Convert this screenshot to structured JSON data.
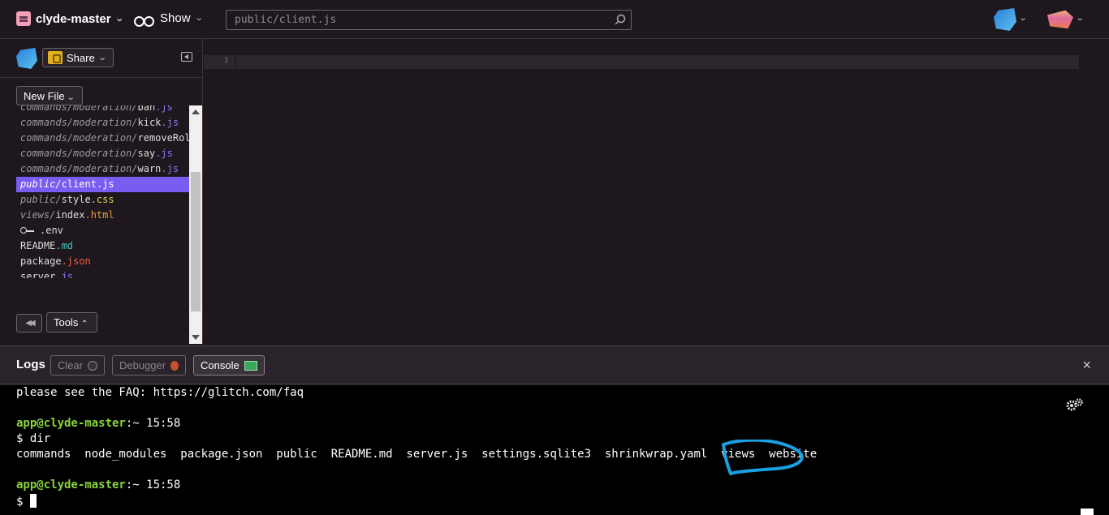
{
  "header": {
    "project_name": "clyde-master",
    "show_label": "Show",
    "search_value": "public/client.js"
  },
  "sidebar": {
    "share_label": "Share",
    "new_file_label": "New File",
    "tools_label": "Tools",
    "files": [
      {
        "dir": "commands/moderation/",
        "name": "ban",
        "ext": ".js",
        "ext_class": "ext-js"
      },
      {
        "dir": "commands/moderation/",
        "name": "kick",
        "ext": ".js",
        "ext_class": "ext-js"
      },
      {
        "dir": "commands/moderation/",
        "name": "removeRol",
        "ext": "",
        "ext_class": "ext-js"
      },
      {
        "dir": "commands/moderation/",
        "name": "say",
        "ext": ".js",
        "ext_class": "ext-js"
      },
      {
        "dir": "commands/moderation/",
        "name": "warn",
        "ext": ".js",
        "ext_class": "ext-js"
      },
      {
        "dir": "public/",
        "name": "client",
        "ext": ".js",
        "ext_class": "ext-js",
        "selected": true
      },
      {
        "dir": "public/",
        "name": "style",
        "ext": ".css",
        "ext_class": "ext-css"
      },
      {
        "dir": "views/",
        "name": "index",
        "ext": ".html",
        "ext_class": "ext-html"
      },
      {
        "dir": "",
        "name": ".env",
        "ext": "",
        "ext_class": "",
        "key_icon": true
      },
      {
        "dir": "",
        "name": "README",
        "ext": ".md",
        "ext_class": "ext-md"
      },
      {
        "dir": "",
        "name": "package",
        "ext": ".json",
        "ext_class": "ext-json"
      },
      {
        "dir": "",
        "name": "server",
        "ext": ".js",
        "ext_class": "ext-js"
      }
    ]
  },
  "editor": {
    "line_number": "1"
  },
  "logs": {
    "title": "Logs",
    "clear_label": "Clear",
    "debugger_label": "Debugger",
    "console_label": "Console",
    "close_symbol": "×"
  },
  "console": {
    "line1": "please see the FAQ: https://glitch.com/faq",
    "prompt1_user": "app@clyde-master",
    "prompt1_rest": ":~ 15:58",
    "cmd1": "$ dir",
    "dir_output": "commands  node_modules  package.json  public  README.md  server.js  settings.sqlite3  shrinkwrap.yaml  views  website",
    "prompt2_user": "app@clyde-master",
    "prompt2_rest": ":~ 15:58",
    "cmd2": "$ "
  },
  "colors": {
    "background": "#1e171e",
    "selected_file": "#7b5cf0",
    "prompt_green": "#8ad43a",
    "annotation_blue": "#1aa0e0"
  }
}
